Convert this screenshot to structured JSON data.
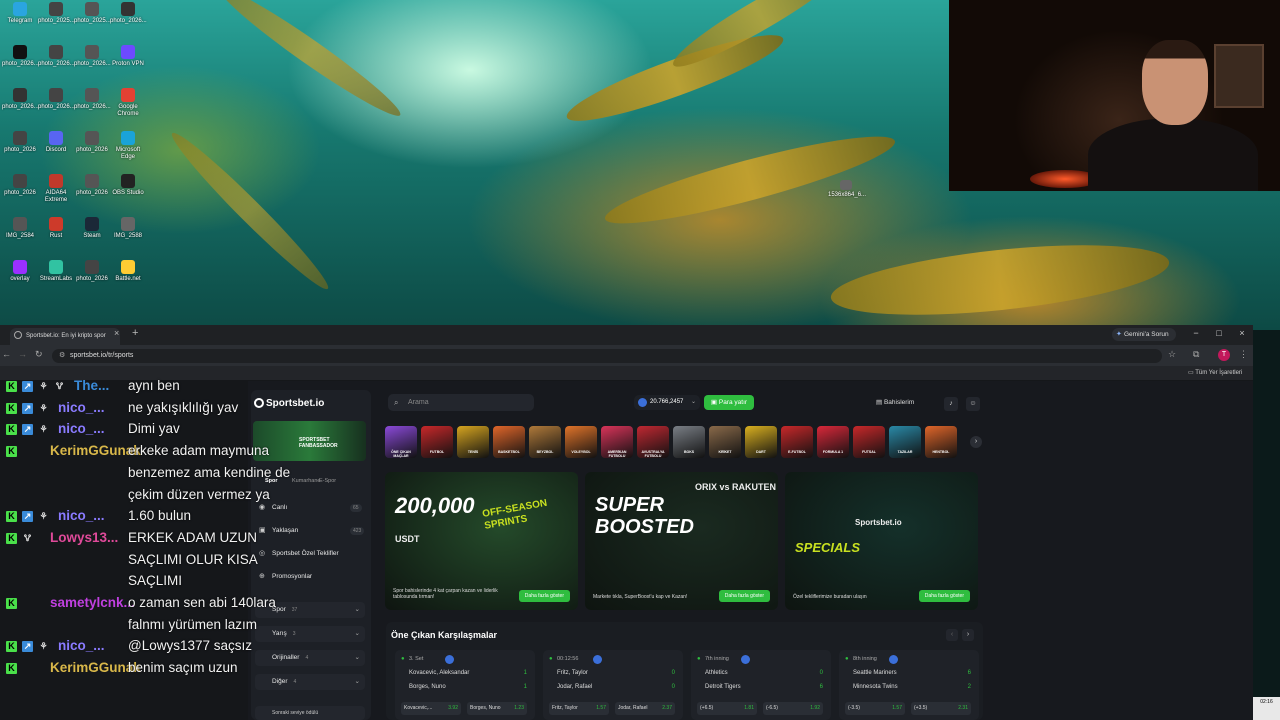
{
  "desktop": {
    "icons": [
      {
        "label": "Telegram",
        "color": "#2aa5e0"
      },
      {
        "label": "photo_2025...",
        "color": "#444"
      },
      {
        "label": "photo_2025...",
        "color": "#555"
      },
      {
        "label": "photo_2026...",
        "color": "#333"
      },
      {
        "label": "photo_2026...",
        "color": "#111"
      },
      {
        "label": "photo_2026...",
        "color": "#444"
      },
      {
        "label": "photo_2026...",
        "color": "#555"
      },
      {
        "label": "Proton VPN",
        "color": "#6d4aff"
      },
      {
        "label": "photo_2026...",
        "color": "#333"
      },
      {
        "label": "photo_2026...",
        "color": "#444"
      },
      {
        "label": "photo_2026...",
        "color": "#555"
      },
      {
        "label": "Google Chrome",
        "color": "#e34133"
      },
      {
        "label": "photo_2026",
        "color": "#444"
      },
      {
        "label": "Discord",
        "color": "#5865f2"
      },
      {
        "label": "photo_2026",
        "color": "#555"
      },
      {
        "label": "Microsoft Edge",
        "color": "#1aa3d9"
      },
      {
        "label": "photo_2026",
        "color": "#444"
      },
      {
        "label": "AIDA64 Extreme",
        "color": "#c0392b"
      },
      {
        "label": "photo_2026",
        "color": "#555"
      },
      {
        "label": "OBS Studio",
        "color": "#222"
      },
      {
        "label": "IMG_2584",
        "color": "#555"
      },
      {
        "label": "Rust",
        "color": "#cd3a2a"
      },
      {
        "label": "Steam",
        "color": "#1b2838"
      },
      {
        "label": "IMG_2588",
        "color": "#666"
      },
      {
        "label": "overlay",
        "color": "#9b30ff"
      },
      {
        "label": "StreamLabs",
        "color": "#31c3a2"
      },
      {
        "label": "photo_2026",
        "color": "#444"
      },
      {
        "label": "Battle.net",
        "color": "#ffcc33"
      }
    ],
    "floating_icon": "1536x864_6..."
  },
  "browser": {
    "tab_title": "Sportsbet.io: En iyi kripto spor",
    "url": "sportsbet.io/tr/sports",
    "gemini_label": "Gemini'a Sorun",
    "all_bookmarks": "Tüm Yer İşaretleri",
    "profile_initial": "T"
  },
  "chat": [
    {
      "user": "The...",
      "user_color": "#3a8bd9",
      "msg": "aynı ben",
      "badges": [
        "k",
        "p",
        "e",
        "gift"
      ]
    },
    {
      "user": "nico_...",
      "user_color": "#8a7bff",
      "msg": "ne yakışıklılığı yav",
      "badges": [
        "k",
        "p",
        "e"
      ]
    },
    {
      "user": "nico_...",
      "user_color": "#8a7bff",
      "msg": "Dimi yav",
      "badges": [
        "k",
        "p",
        "e"
      ]
    },
    {
      "user": "KerimGGunak",
      "user_color": "#d9b84a",
      "msg": "erkeke adam maymuna",
      "badges": [
        "k"
      ]
    },
    {
      "user": "",
      "user_color": "#d9b84a",
      "msg": "benzemez ama kendine de",
      "badges": []
    },
    {
      "user": "",
      "user_color": "#d9b84a",
      "msg": "çekim düzen vermez ya",
      "badges": []
    },
    {
      "user": "nico_...",
      "user_color": "#8a7bff",
      "msg": "1.60 bulun",
      "badges": [
        "k",
        "p",
        "e"
      ]
    },
    {
      "user": "Lowys13...",
      "user_color": "#e04a9a",
      "msg": "ERKEK ADAM UZUN",
      "badges": [
        "k",
        "gift"
      ]
    },
    {
      "user": "",
      "user_color": "#e04a9a",
      "msg": "SAÇLIMI OLUR KISA",
      "badges": []
    },
    {
      "user": "",
      "user_color": "#e04a9a",
      "msg": "SAÇLIMI",
      "badges": []
    },
    {
      "user": "sametylcnk...",
      "user_color": "#c040e0",
      "msg": "o zaman sen abi 140lara",
      "badges": [
        "k"
      ]
    },
    {
      "user": "",
      "user_color": "#c040e0",
      "msg": "falnmı yürümen lazım",
      "badges": []
    },
    {
      "user": "nico_...",
      "user_color": "#8a7bff",
      "msg": "@Lowys1377 saçsız",
      "badges": [
        "k",
        "p",
        "e"
      ]
    },
    {
      "user": "KerimGGunak",
      "user_color": "#d9b84a",
      "msg": "benim saçım uzun",
      "badges": [
        "k"
      ]
    }
  ],
  "sportsbet": {
    "logo": "Sportsbet.io",
    "search_placeholder": "Arama",
    "balance": "20.766,2457",
    "deposit": "Para yatır",
    "my_bets": "Bahislerim",
    "banner_title": "SPORTSBET FANBASSADOR",
    "side_tabs": [
      "Spor",
      "Kumarhane",
      "E-Spor"
    ],
    "side_items": [
      {
        "label": "Canlı",
        "count": "65"
      },
      {
        "label": "Yaklaşan",
        "count": "423"
      },
      {
        "label": "Sportsbet Özel Teklifler",
        "count": ""
      },
      {
        "label": "Promosyonlar",
        "count": ""
      }
    ],
    "side_cats": [
      {
        "label": "Spor",
        "count": "37"
      },
      {
        "label": "Yarış",
        "count": "3"
      },
      {
        "label": "Orijinaller",
        "count": "4"
      },
      {
        "label": "Diğer",
        "count": "4"
      }
    ],
    "level_text": "Sonraki seviye ödülü",
    "sports": [
      {
        "label": "ÖNE ÇIKAN MAÇLAR",
        "color": "#8b4ad9"
      },
      {
        "label": "FUTBOL",
        "color": "#c8282a"
      },
      {
        "label": "TENİS",
        "color": "#d6a520"
      },
      {
        "label": "BASKETBOL",
        "color": "#e0662a"
      },
      {
        "label": "BEYZBOL",
        "color": "#b07a3a"
      },
      {
        "label": "VOLEYBOL",
        "color": "#e0742a"
      },
      {
        "label": "AMERİKAN FUTBOLU",
        "color": "#d9345a"
      },
      {
        "label": "AVUSTRALYA FUTBOLU",
        "color": "#c02832"
      },
      {
        "label": "BOKS",
        "color": "#7a7f86"
      },
      {
        "label": "KRİKET",
        "color": "#8a6a4a"
      },
      {
        "label": "DART",
        "color": "#d9b020"
      },
      {
        "label": "E-FUTBOL",
        "color": "#c8282a"
      },
      {
        "label": "FORMULA 1",
        "color": "#d9283a"
      },
      {
        "label": "FUTSAL",
        "color": "#c8282a"
      },
      {
        "label": "TAZILAR",
        "color": "#2a8aa8"
      },
      {
        "label": "HENTBOL",
        "color": "#e0662a"
      },
      {
        "label": "",
        "color": "#2a9a9a"
      }
    ],
    "promos": [
      {
        "big": "200,000",
        "sub": "USDT",
        "headline": "OFF-SEASON SPRINTS",
        "text": "Spor bahislerinde 4 kat çarpan kazan ve liderlik tablosunda tırman!",
        "button": "Daha fazla göster",
        "color": "#244a2a"
      },
      {
        "big": "SUPER BOOSTED",
        "sub": "ORIX vs RAKUTEN",
        "headline": "",
        "text": "Markete tıkla, SuperBoost'u kap ve Kazan!",
        "button": "Daha fazla göster",
        "color": "#1a2a20"
      },
      {
        "big": "SPECIALS",
        "sub": "Sportsbet.io",
        "headline": "",
        "text": "Özel tekliflerimize buradan ulaşın",
        "button": "Daha fazla göster",
        "color": "#14302a"
      }
    ],
    "featured_title": "Öne Çıkan Karşılaşmalar",
    "matches": [
      {
        "status": "3. Set",
        "team1": "Kovacevic, Aleksandar",
        "team2": "Borges, Nuno",
        "s1": "1",
        "s2": "1",
        "o1_label": "Kovacevic,...",
        "o1": "3.92",
        "o2_label": "Borges, Nuno",
        "o2": "1.23"
      },
      {
        "status": "00:12:56",
        "team1": "Fritz, Taylor",
        "team2": "Jodar, Rafael",
        "s1": "0",
        "s2": "0",
        "o1_label": "Fritz, Taylor",
        "o1": "1.57",
        "o2_label": "Jodar, Rafael",
        "o2": "2.37"
      },
      {
        "status": "7th inning",
        "team1": "Athletics",
        "team2": "Detroit Tigers",
        "s1": "0",
        "s2": "6",
        "o1_label": "(+6.5)",
        "o1": "1.81",
        "o2_label": "(-6.5)",
        "o2": "1.92"
      },
      {
        "status": "8th inning",
        "team1": "Seattle Mariners",
        "team2": "Minnesota Twins",
        "s1": "6",
        "s2": "2",
        "o1_label": "(-3.5)",
        "o1": "1.57",
        "o2_label": "(+3.5)",
        "o2": "2.31"
      }
    ]
  },
  "taskbar_clock": "02:16"
}
